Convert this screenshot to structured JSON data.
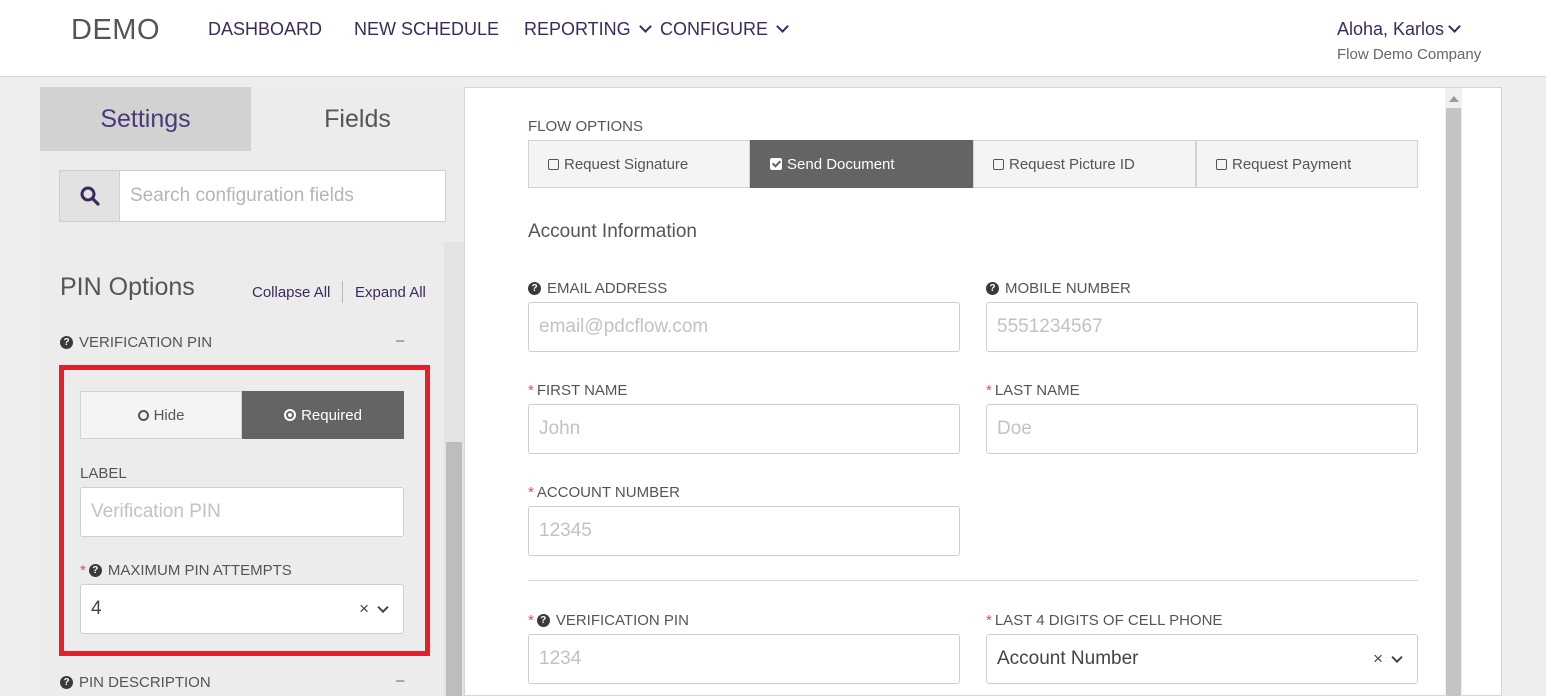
{
  "header": {
    "logo": "DEMO",
    "nav": {
      "dashboard": "DASHBOARD",
      "new_schedule": "NEW SCHEDULE",
      "reporting": "REPORTING",
      "configure": "CONFIGURE"
    },
    "user": "Aloha, Karlos",
    "company": "Flow Demo Company"
  },
  "left": {
    "tabs": {
      "settings": "Settings",
      "fields": "Fields"
    },
    "search_placeholder": "Search configuration fields",
    "section_title": "PIN Options",
    "collapse_all": "Collapse All",
    "expand_all": "Expand All",
    "verification_pin": {
      "heading": "VERIFICATION PIN",
      "toggle_hide": "Hide",
      "toggle_required": "Required",
      "label_caption": "LABEL",
      "label_placeholder": "Verification PIN",
      "max_attempts_caption": "MAXIMUM PIN ATTEMPTS",
      "max_attempts_value": "4"
    },
    "pin_description": {
      "heading": "PIN DESCRIPTION"
    },
    "minus": "–"
  },
  "right": {
    "flow_options_label": "FLOW OPTIONS",
    "flow_options": {
      "request_signature": "Request Signature",
      "send_document": "Send Document",
      "request_picture_id": "Request Picture ID",
      "request_payment": "Request Payment"
    },
    "account_information": "Account Information",
    "fields": {
      "email_label": "EMAIL ADDRESS",
      "email_placeholder": "email@pdcflow.com",
      "mobile_label": "MOBILE NUMBER",
      "mobile_placeholder": "5551234567",
      "first_label": "FIRST NAME",
      "first_placeholder": "John",
      "last_label": "LAST NAME",
      "last_placeholder": "Doe",
      "account_label": "ACCOUNT NUMBER",
      "account_placeholder": "12345",
      "pin_label": "VERIFICATION PIN",
      "pin_placeholder": "1234",
      "cell_label": "LAST 4 DIGITS OF CELL PHONE",
      "cell_value": "Account Number"
    }
  },
  "glyphs": {
    "required": "*",
    "help": "?",
    "clear": "×"
  },
  "colors": {
    "accent": "#3c2a5e",
    "active_toggle": "#646464",
    "highlight": "#e2202c",
    "required": "#d9534f"
  }
}
